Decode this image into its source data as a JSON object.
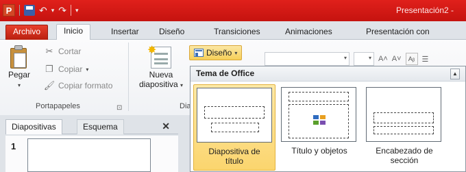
{
  "window": {
    "title": "Presentación2 -",
    "qat": {
      "app_icon": "P",
      "undo_glyph": "↶",
      "redo_glyph": "↷",
      "dropdown_glyph": "▾"
    }
  },
  "tabs": [
    "Archivo",
    "Inicio",
    "Insertar",
    "Diseño",
    "Transiciones",
    "Animaciones",
    "Presentación con diaposit"
  ],
  "ribbon": {
    "clipboard": {
      "paste_label": "Pegar",
      "cut_label": "Cortar",
      "copy_label": "Copiar",
      "format_label": "Copiar formato",
      "group_label": "Portapapeles"
    },
    "slides": {
      "new_slide_line1": "Nueva",
      "new_slide_line2": "diapositiva",
      "layout_button": "Diseño",
      "group_label_partial": "Diap"
    }
  },
  "panel": {
    "tabs": [
      "Diapositivas",
      "Esquema"
    ],
    "close": "✕",
    "slide_number": "1"
  },
  "gallery": {
    "header": "Tema de Office",
    "layouts": [
      {
        "line1": "Diapositiva de",
        "line2": "título",
        "selected": true
      },
      {
        "line1": "Título y objetos",
        "line2": "",
        "selected": false
      },
      {
        "line1": "Encabezado de",
        "line2": "sección",
        "selected": false
      }
    ]
  },
  "colors": {
    "accent": "#c5130f",
    "selection": "#fbd56e",
    "archivo": "#d0301c"
  }
}
